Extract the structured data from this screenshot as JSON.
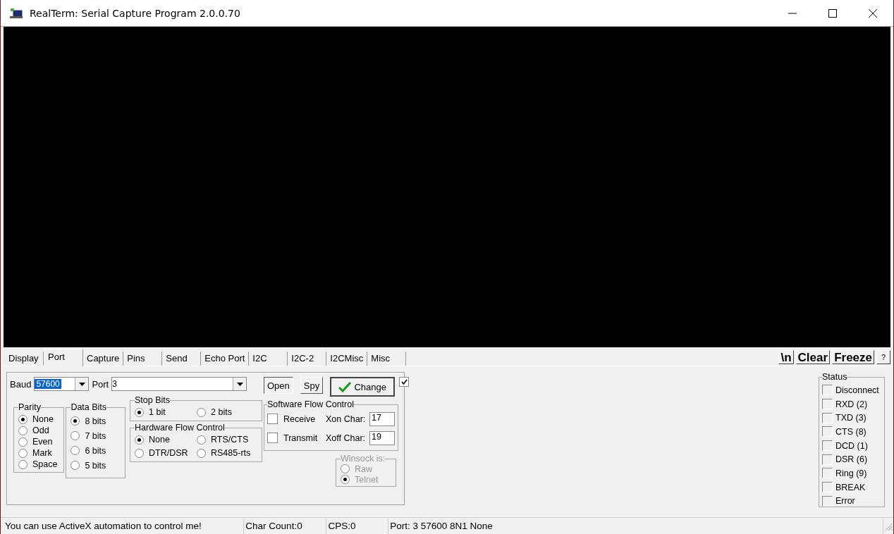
{
  "window": {
    "title": "RealTerm: Serial Capture Program 2.0.0.70"
  },
  "tabs": [
    {
      "label": "Display",
      "selected": false
    },
    {
      "label": "Port",
      "selected": true
    },
    {
      "label": "Capture",
      "selected": false
    },
    {
      "label": "Pins",
      "selected": false
    },
    {
      "label": "Send",
      "selected": false
    },
    {
      "label": "Echo Port",
      "selected": false
    },
    {
      "label": "I2C",
      "selected": false
    },
    {
      "label": "I2C-2",
      "selected": false
    },
    {
      "label": "I2CMisc",
      "selected": false
    },
    {
      "label": "Misc",
      "selected": false
    }
  ],
  "toolbar_buttons": [
    {
      "label": "\\n",
      "kind": "big"
    },
    {
      "label": "Clear",
      "kind": "big"
    },
    {
      "label": "Freeze",
      "kind": "big"
    },
    {
      "label": "?",
      "kind": "small"
    }
  ],
  "port": {
    "baud_label": "Baud",
    "baud": "57600",
    "port_label": "Port",
    "port": "3",
    "open": "Open",
    "spy": "Spy",
    "change": "Change",
    "change_checked": true,
    "parity": {
      "title": "Parity",
      "options": [
        {
          "label": "None",
          "selected": true
        },
        {
          "label": "Odd",
          "selected": false
        },
        {
          "label": "Even",
          "selected": false
        },
        {
          "label": "Mark",
          "selected": false
        },
        {
          "label": "Space",
          "selected": false
        }
      ]
    },
    "data_bits": {
      "title": "Data Bits",
      "options": [
        {
          "label": "8 bits",
          "selected": true
        },
        {
          "label": "7 bits",
          "selected": false
        },
        {
          "label": "6 bits",
          "selected": false
        },
        {
          "label": "5 bits",
          "selected": false
        }
      ]
    },
    "stop_bits": {
      "title": "Stop Bits",
      "options": [
        {
          "label": "1 bit",
          "selected": true
        },
        {
          "label": "2 bits",
          "selected": false
        }
      ]
    },
    "hardware_flow": {
      "title": "Hardware Flow Control",
      "options": [
        {
          "label": "None",
          "selected": true
        },
        {
          "label": "RTS/CTS",
          "selected": false
        },
        {
          "label": "DTR/DSR",
          "selected": false
        },
        {
          "label": "RS485-rts",
          "selected": false
        }
      ]
    },
    "software_flow": {
      "title": "Software Flow Control",
      "rows": [
        {
          "label": "Receive",
          "checked": false,
          "char_label": "Xon Char:",
          "char_value": "17"
        },
        {
          "label": "Transmit",
          "checked": false,
          "char_label": "Xoff Char:",
          "char_value": "19"
        }
      ]
    },
    "winsock": {
      "title": "Winsock is:",
      "disabled": true,
      "options": [
        {
          "label": "Raw",
          "selected": false
        },
        {
          "label": "Telnet",
          "selected": true
        }
      ]
    }
  },
  "status": {
    "title": "Status",
    "items": [
      {
        "label": "Disconnect",
        "on": false
      },
      {
        "label": "RXD (2)",
        "on": false
      },
      {
        "label": "TXD (3)",
        "on": false
      },
      {
        "label": "CTS (8)",
        "on": false
      },
      {
        "label": "DCD (1)",
        "on": false
      },
      {
        "label": "DSR (6)",
        "on": false
      },
      {
        "label": "Ring (9)",
        "on": false
      },
      {
        "label": "BREAK",
        "on": false
      },
      {
        "label": "Error",
        "on": false
      }
    ]
  },
  "status_bar": [
    "You can use ActiveX automation to control me!",
    "Char Count:0",
    "CPS:0",
    "Port: 3 57600 8N1 None"
  ]
}
